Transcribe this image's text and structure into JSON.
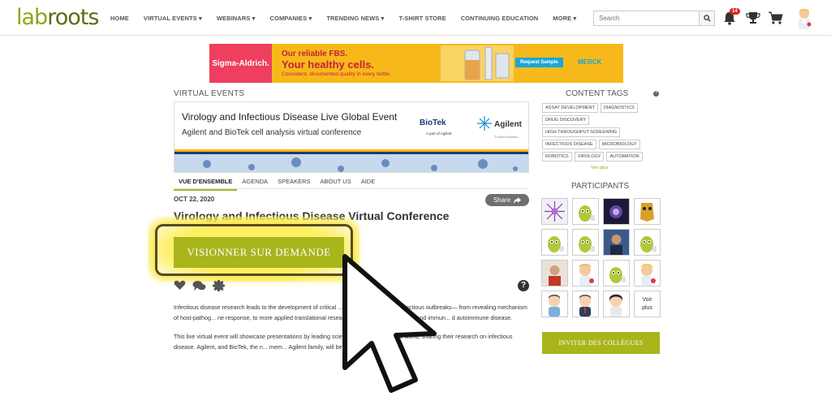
{
  "header": {
    "logo_lab": "lab",
    "logo_roots": "roots",
    "nav": [
      "HOME",
      "VIRTUAL EVENTS ▾",
      "WEBINARS ▾",
      "COMPANIES ▾",
      "TRENDING NEWS ▾",
      "T-SHIRT STORE",
      "CONTINUING EDUCATION",
      "MORE ▾"
    ],
    "search_placeholder": "Search",
    "notification_count": "14"
  },
  "ad": {
    "brand": "Sigma-Aldrich.",
    "line1": "Our reliable FBS.",
    "line2": "Your healthy cells.",
    "line3": "Consistent, documented quality in every bottle.",
    "request": "Request Sample",
    "merck": "MERCK"
  },
  "event": {
    "section_title": "VIRTUAL EVENTS",
    "title": "Virology and Infectious Disease Live Global Event",
    "subtitle": "Agilent and BioTek cell analysis virtual conference",
    "biotek": "BioTek",
    "biotek_sub": "A part of Agilent",
    "agilent": "Agilent",
    "agilent_sub": "Trusted Answers"
  },
  "tabs": [
    "VUE D'ENSEMBLE",
    "AGENDA",
    "SPEAKERS",
    "ABOUT US",
    "AIDE"
  ],
  "main": {
    "date": "OCT 22, 2020",
    "share": "Share",
    "title": "Virology and Infectious Disease Virtual Conference",
    "watch_button": "VISIONNER SUR DEMANDE",
    "desc1": "Infectious disease research leads to the development of critical ... t, present, and future infectious outbreaks— from revealing mechanism of host-pathog... ne response, to more applied translational research on vaccine development and immun... d autoimmune disease.",
    "desc2": "This live virtual event will showcase presentations by leading scientis... utions around the world, sharing their research on infectious disease. Agilent, and BioTek, the n... mem... Agilent family, will be"
  },
  "sidebar": {
    "tags_title": "CONTENT TAGS",
    "tags": [
      "ASSAY DEVELOPMENT",
      "DIAGNOSTICS",
      "DRUG DISCOVERY",
      "HIGH THROUGHPUT SCREENING",
      "INFECTIOUS DISEASE",
      "MICROBIOLOGY",
      "ROBOTICS",
      "VIROLOGY",
      "AUTOMATION"
    ],
    "tags_more": "Voir plus",
    "participants_title": "PARTICIPANTS",
    "participants_more_1": "Voir",
    "participants_more_2": "plus",
    "invite_button": "INVITER DES COLLÈGUES"
  },
  "colors": {
    "accent": "#a8b51b",
    "logo_dark": "#5d6b0e",
    "badge": "#d9261c"
  }
}
